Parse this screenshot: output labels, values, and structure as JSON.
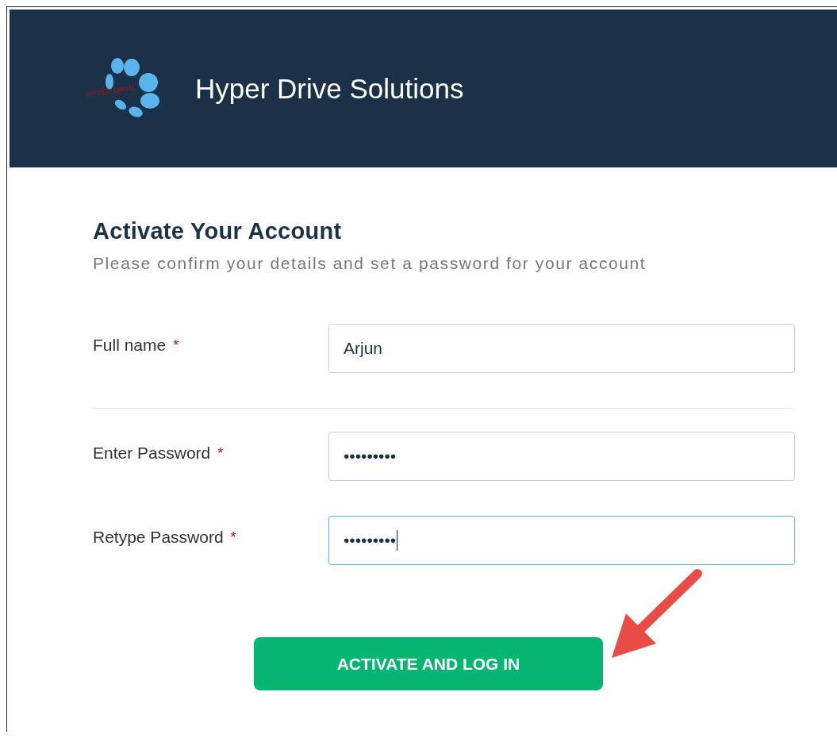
{
  "header": {
    "logo_text": "HYPER DRIVE",
    "title": "Hyper Drive Solutions"
  },
  "form": {
    "title": "Activate Your Account",
    "subtitle": "Please confirm your details and set a password for your account",
    "fields": [
      {
        "label": "Full name",
        "required": "*",
        "value": "Arjun",
        "focused": false,
        "divider_after": true
      },
      {
        "label": "Enter Password",
        "required": "*",
        "value": "•••••••••",
        "focused": false,
        "divider_after": false
      },
      {
        "label": "Retype Password",
        "required": "*",
        "value": "•••••••••",
        "focused": true,
        "divider_after": false
      }
    ],
    "submit": "ACTIVATE AND LOG IN",
    "callout_arrow": true
  }
}
